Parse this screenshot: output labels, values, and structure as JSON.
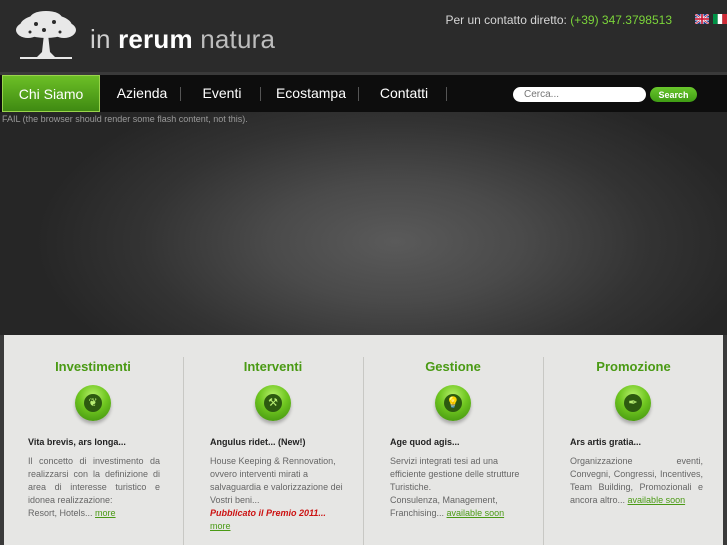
{
  "header": {
    "logo_parts": [
      "in",
      "rerum",
      "natura"
    ],
    "contact_label": "Per un contatto diretto:",
    "contact_phone": "(+39) 347.3798513",
    "flags": [
      "uk-flag-icon",
      "italy-flag-icon"
    ]
  },
  "nav": {
    "items": [
      {
        "label": "Chi Siamo",
        "active": true
      },
      {
        "label": "Azienda",
        "active": false
      },
      {
        "label": "Eventi",
        "active": false
      },
      {
        "label": "Ecostampa",
        "active": false
      },
      {
        "label": "Contatti",
        "active": false
      }
    ]
  },
  "search": {
    "placeholder": "Cerca...",
    "button_label": "Search"
  },
  "flash": {
    "message": "FAIL (the browser should render some flash content, not this)."
  },
  "columns": [
    {
      "title": "Investimenti",
      "icon": "leaf-icon",
      "heading": "Vita brevis, ars longa...",
      "body": "Il concetto di investimento da realizzarsi con la definizione di area di interesse turistico e idonea realizzazione:",
      "tail": "Resort, Hotels...",
      "link": "more"
    },
    {
      "title": "Interventi",
      "icon": "wrench-icon",
      "heading": "Angulus ridet... (New!)",
      "body": "House Keeping & Rennovation, ovvero interventi mirati a salvaguardia e valorizzazione dei Vostri beni...",
      "award": "Pubblicato il Premio 2011...",
      "link": "more"
    },
    {
      "title": "Gestione",
      "icon": "lightbulb-icon",
      "heading": "Age quod agis...",
      "body": "Servizi integrati tesi ad una efficiente gestione delle strutture Turistiche.",
      "tail": "Consulenza, Management, Franchising...",
      "link": "available soon"
    },
    {
      "title": "Promozione",
      "icon": "pen-nib-icon",
      "heading": "Ars artis gratia...",
      "body": "Organizzazione eventi, Convegni, Congressi, Incentives, Team Building, Promozionali e ancora altro...",
      "link": "available soon"
    }
  ],
  "colors": {
    "accent": "#4a9a14",
    "nav_active": "#5aae1c",
    "award": "#cc1111"
  }
}
